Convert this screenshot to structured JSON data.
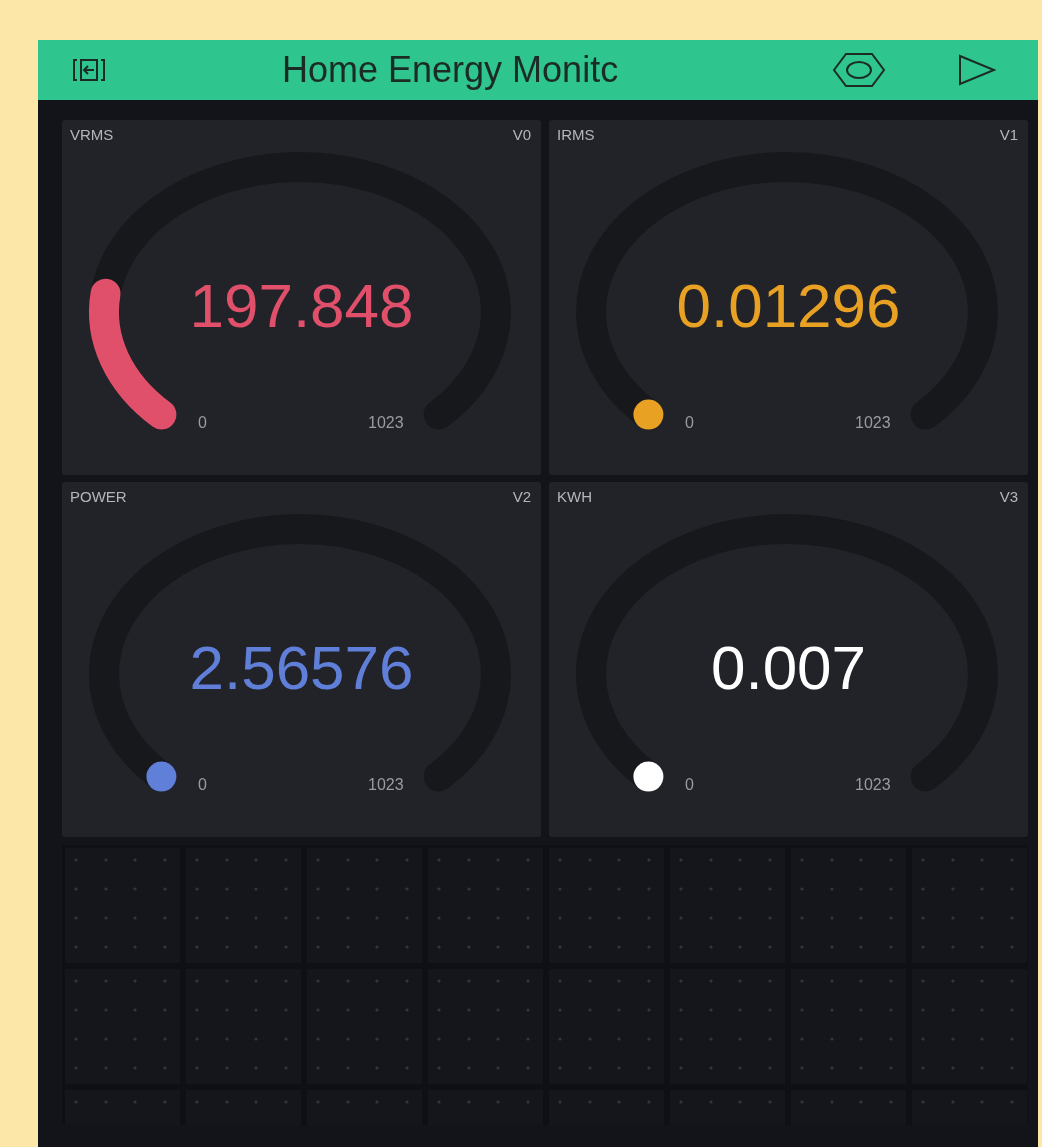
{
  "header": {
    "title": "Home Energy Monitc"
  },
  "gauges": [
    {
      "label": "VRMS",
      "pin": "V0",
      "value": "197.848",
      "min": "0",
      "max": "1023",
      "color": "#e0506a"
    },
    {
      "label": "IRMS",
      "pin": "V1",
      "value": "0.01296",
      "min": "0",
      "max": "1023",
      "color": "#e8a123"
    },
    {
      "label": "POWER",
      "pin": "V2",
      "value": "2.56576",
      "min": "0",
      "max": "1023",
      "color": "#5f7fd8"
    },
    {
      "label": "KWH",
      "pin": "V3",
      "value": "0.007",
      "min": "0",
      "max": "1023",
      "color": "#ffffff"
    }
  ]
}
